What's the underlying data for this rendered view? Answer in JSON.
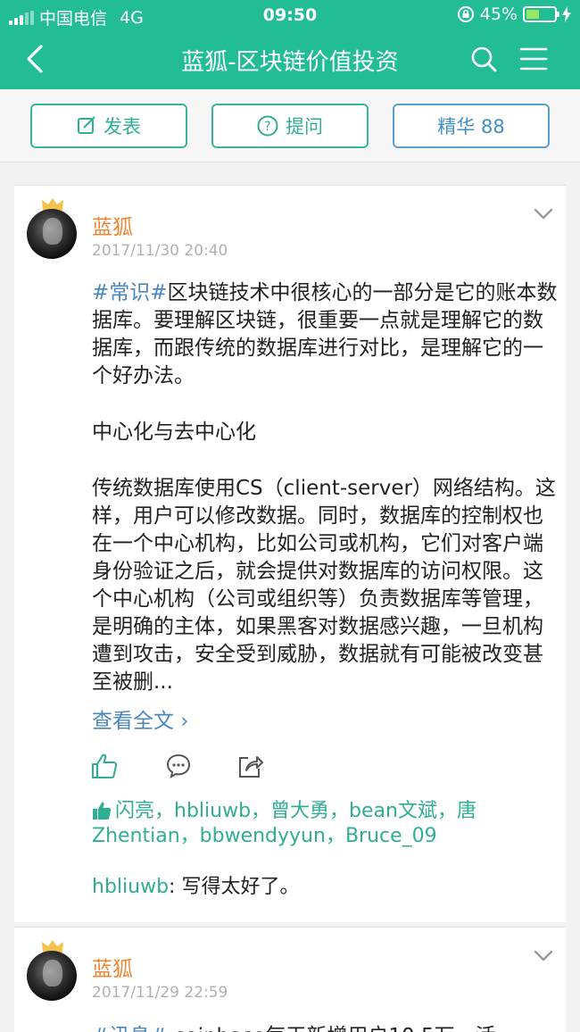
{
  "status_bar": {
    "carrier": "中国电信",
    "network": "4G",
    "time": "09:50",
    "battery": "45%",
    "battery_level": 0.45
  },
  "nav": {
    "title": "蓝狐-区块链价值投资"
  },
  "actions_bar": {
    "post_label": "发表",
    "ask_label": "提问",
    "featured_label": "精华 88"
  },
  "posts": [
    {
      "author": "蓝狐",
      "date": "2017/11/30 20:40",
      "tag": "#常识#",
      "paragraphs": [
        "区块链技术中很核心的一部分是它的账本数据库。要理解区块链，很重要一点就是理解它的数据库，而跟传统的数据库进行对比，是理解它的一个好办法。",
        "中心化与去中心化",
        "传统数据库使用CS（client-server）网络结构。这样，用户可以修改数据。同时，数据库的控制权也在一个中心机构，比如公司或机构，它们对客户端身份验证之后，就会提供对数据库的访问权限。这个中心机构（公司或组织等）负责数据库等管理，是明确的主体，如果黑客对数据感兴趣，一旦机构遭到攻击，安全受到威胁，数据就有可能被改变甚至被删..."
      ],
      "view_all": "查看全文 ›",
      "likers": "闪亮，hbliuwb，曾大勇，bean文斌，唐Zhentian，bbwendyyun，Bruce_09",
      "comment_user": "hbliuwb",
      "comment_text": ": 写得太好了。"
    },
    {
      "author": "蓝狐",
      "date": "2017/11/29 22:59",
      "tag": "#讯息#",
      "preview": " coinbase每天新增用户10.5万，活"
    }
  ]
}
